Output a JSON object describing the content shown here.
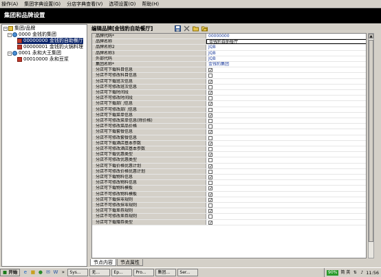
{
  "menu": [
    "操作(A)",
    "集团字典设置(G)",
    "分店字典查看(V)",
    "选项设置(O)",
    "帮助(H)"
  ],
  "window_title": "集团和品牌设置",
  "tree": {
    "root": "集团/品牌",
    "nodes": [
      {
        "label": "0000 金钱豹集团",
        "children": [
          {
            "label": "00000000 金钱豹自助餐厅",
            "selected": true
          },
          {
            "label": "00000001 金钱豹火锅料理"
          }
        ]
      },
      {
        "label": "0001 永和大王集团",
        "children": [
          {
            "label": "00010000 永和豆浆"
          }
        ]
      }
    ]
  },
  "editor": {
    "title": "编辑品牌[金钱豹自助餐厅]",
    "toolbar_icons": [
      "save-icon",
      "delete-icon",
      "folder-icon",
      "open-icon"
    ],
    "check_mark": "✓",
    "rows": [
      {
        "label": "品牌代码*",
        "value": "00000000"
      },
      {
        "label": "品牌名称",
        "value": "金钱豹自助餐厅",
        "editing": true
      },
      {
        "label": "品牌名称2",
        "value": "JQB"
      },
      {
        "label": "品牌名称3",
        "value": "JQB"
      },
      {
        "label": "外部代码",
        "value": "JQB"
      },
      {
        "label": "集团名称*",
        "value": "金钱豹集团"
      },
      {
        "label": "分店可下载科目信息",
        "checked": true
      },
      {
        "label": "分店不可修改科目信息",
        "checked": false
      },
      {
        "label": "分店可下载班次信息",
        "checked": true
      },
      {
        "label": "分店不可修改班次信息",
        "checked": false
      },
      {
        "label": "分店可下载时间段",
        "checked": true
      },
      {
        "label": "分店不可修改时间段",
        "checked": false
      },
      {
        "label": "分店可下载部门信息",
        "checked": true
      },
      {
        "label": "分店不可修改部门信息",
        "checked": false
      },
      {
        "label": "分店可下载菜单信息",
        "checked": true
      },
      {
        "label": "分店不可修改菜单信息(除价格)",
        "checked": false
      },
      {
        "label": "分店不可修改菜品价格",
        "checked": false
      },
      {
        "label": "分店可下载套餐信息",
        "checked": true
      },
      {
        "label": "分店不可修改套餐信息",
        "checked": false
      },
      {
        "label": "分店可下载酒店基本参数",
        "checked": true
      },
      {
        "label": "分店不可修改酒店基本参数",
        "checked": false
      },
      {
        "label": "分店可下载优惠类型",
        "checked": true
      },
      {
        "label": "分店不可修改优惠类型",
        "checked": false
      },
      {
        "label": "分店可下载价格优惠计划",
        "checked": true
      },
      {
        "label": "分店不可修改价格优惠计划",
        "checked": false
      },
      {
        "label": "分店可下载物料信息",
        "checked": true
      },
      {
        "label": "分店不可修改物料信息",
        "checked": false
      },
      {
        "label": "分店可下载物料模板",
        "checked": true
      },
      {
        "label": "分店不可修改物料模板",
        "checked": true
      },
      {
        "label": "分店可下载抹零规则",
        "checked": true
      },
      {
        "label": "分店不可修改抹零规则",
        "checked": false
      },
      {
        "label": "分店可下载差券规则",
        "checked": true
      },
      {
        "label": "分店不可修改差券规则",
        "checked": false
      },
      {
        "label": "分店可下载赠券类型",
        "checked": true
      }
    ]
  },
  "tabs": [
    "节点内容",
    "节点属性"
  ],
  "taskbar": {
    "start": "开始",
    "quick_icons": [
      "ie-icon",
      "folder-icon",
      "media-icon",
      "outlook-icon",
      "word-icon"
    ],
    "more": "»",
    "buttons": [
      "Sys...",
      "无...",
      "Ep...",
      "Pro...",
      "集团...",
      "Ser..."
    ],
    "battery": "90%",
    "ime": "简 英",
    "clock": "11:56"
  }
}
